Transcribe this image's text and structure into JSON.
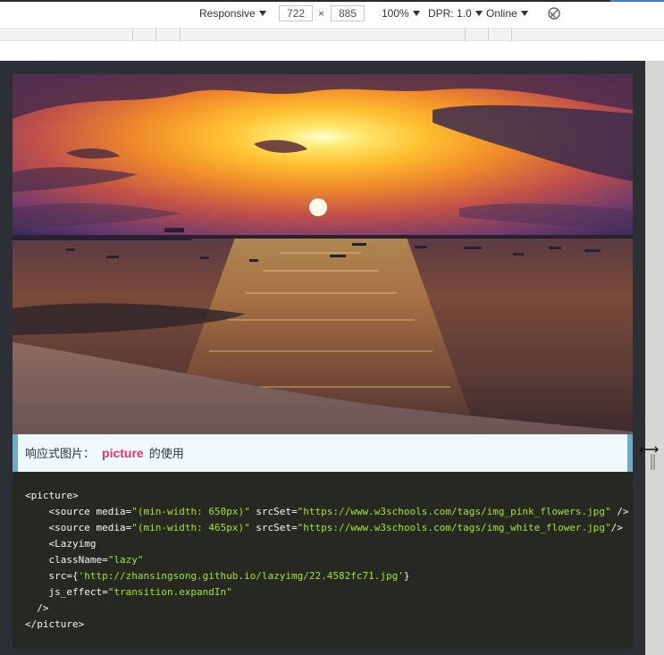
{
  "devtools": {
    "device_mode": "Responsive",
    "width": "722",
    "height": "885",
    "zoom": "100%",
    "dpr": "DPR: 1.0",
    "network": "Online",
    "times_sign": "×"
  },
  "caption": {
    "prefix": "响应式图片：",
    "tag": "picture",
    "suffix": "的使用"
  },
  "code": {
    "lines": [
      [
        {
          "t": "tk",
          "v": "<picture>"
        }
      ],
      [
        {
          "t": "tk",
          "v": "    <source "
        },
        {
          "t": "at",
          "v": "media="
        },
        {
          "t": "st",
          "v": "\"(min-width: 650px)\""
        },
        {
          "t": "at",
          "v": " srcSet="
        },
        {
          "t": "st",
          "v": "\"https://www.w3schools.com/tags/img_pink_flowers.jpg\""
        },
        {
          "t": "tk",
          "v": " />"
        }
      ],
      [
        {
          "t": "tk",
          "v": "    <source "
        },
        {
          "t": "at",
          "v": "media="
        },
        {
          "t": "st",
          "v": "\"(min-width: 465px)\""
        },
        {
          "t": "at",
          "v": " srcSet="
        },
        {
          "t": "st",
          "v": "\"https://www.w3schools.com/tags/img_white_flower.jpg\""
        },
        {
          "t": "tk",
          "v": "/>"
        }
      ],
      [
        {
          "t": "tk",
          "v": "    <Lazyimg"
        }
      ],
      [
        {
          "t": "at",
          "v": "    className="
        },
        {
          "t": "st",
          "v": "\"lazy\""
        }
      ],
      [
        {
          "t": "at",
          "v": "    src={"
        },
        {
          "t": "st",
          "v": "'http://zhansingsong.github.io/lazyimg/22.4582fc71.jpg'"
        },
        {
          "t": "at",
          "v": "}"
        }
      ],
      [
        {
          "t": "at",
          "v": "    js_effect="
        },
        {
          "t": "st",
          "v": "\"transition.expandIn\""
        }
      ],
      [
        {
          "t": "tk",
          "v": "  />"
        }
      ],
      [
        {
          "t": "tk",
          "v": "</picture>"
        }
      ]
    ]
  },
  "icons": {
    "rotate": "rotate-icon",
    "resize": "resize-handle-icon",
    "photo": "sunset-photo"
  }
}
